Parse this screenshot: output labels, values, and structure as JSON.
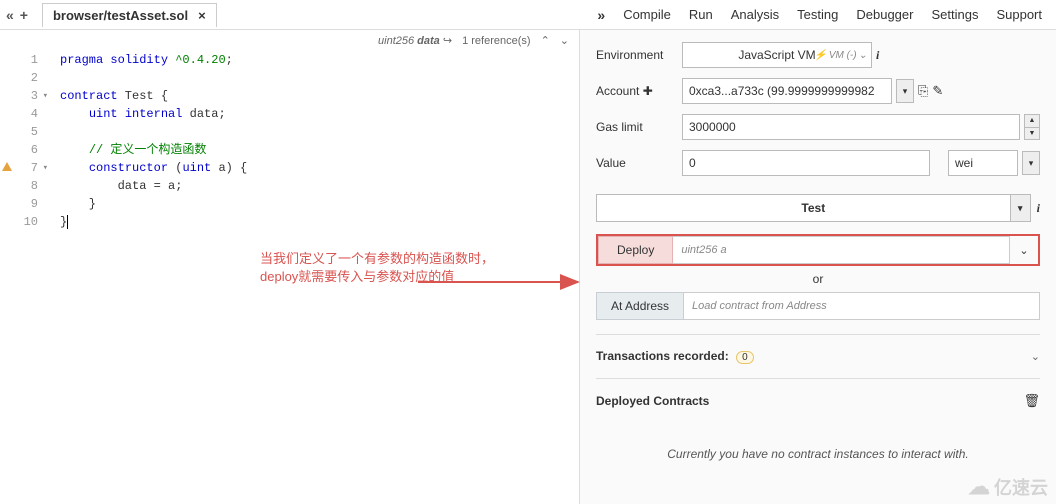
{
  "tabs": {
    "file_name": "browser/testAsset.sol",
    "nav": [
      "Compile",
      "Run",
      "Analysis",
      "Testing",
      "Debugger",
      "Settings",
      "Support"
    ],
    "active_nav": "Run"
  },
  "editor": {
    "hint_type": "uint256",
    "hint_name": "data",
    "references": "1 reference(s)",
    "lines": [
      {
        "n": 1,
        "tokens": [
          [
            "kw",
            "pragma"
          ],
          [
            "",
            " "
          ],
          [
            "kw",
            "solidity"
          ],
          [
            "",
            " "
          ],
          [
            "str",
            "^0.4.20"
          ],
          [
            "",
            ";"
          ]
        ]
      },
      {
        "n": 2,
        "tokens": []
      },
      {
        "n": 3,
        "fold": true,
        "tokens": [
          [
            "kw",
            "contract"
          ],
          [
            "",
            " Test {"
          ]
        ]
      },
      {
        "n": 4,
        "tokens": [
          [
            "",
            "    "
          ],
          [
            "type",
            "uint"
          ],
          [
            "",
            " "
          ],
          [
            "kw",
            "internal"
          ],
          [
            "",
            " data;"
          ]
        ]
      },
      {
        "n": 5,
        "tokens": []
      },
      {
        "n": 6,
        "tokens": [
          [
            "",
            "    "
          ],
          [
            "comment",
            "// 定义一个构造函数"
          ]
        ]
      },
      {
        "n": 7,
        "warn": true,
        "fold": true,
        "tokens": [
          [
            "",
            "    "
          ],
          [
            "kw",
            "constructor"
          ],
          [
            "",
            " ("
          ],
          [
            "type",
            "uint"
          ],
          [
            "",
            " a) {"
          ]
        ]
      },
      {
        "n": 8,
        "tokens": [
          [
            "",
            "        data = a;"
          ]
        ]
      },
      {
        "n": 9,
        "tokens": [
          [
            "",
            "    }"
          ]
        ]
      },
      {
        "n": 10,
        "cursor": true,
        "tokens": [
          [
            "",
            "}"
          ]
        ]
      }
    ]
  },
  "annotation": {
    "line1": "当我们定义了一个有参数的构造函数时，",
    "line2": "deploy就需要传入与参数对应的值"
  },
  "run": {
    "env_label": "Environment",
    "env_value": "JavaScript VM",
    "vm_badge": "VM (-)",
    "account_label": "Account",
    "account_value": "0xca3...a733c (99.9999999999982",
    "gas_label": "Gas limit",
    "gas_value": "3000000",
    "value_label": "Value",
    "value_value": "0",
    "value_unit": "wei",
    "contract_name": "Test",
    "deploy_label": "Deploy",
    "deploy_placeholder": "uint256 a",
    "or_text": "or",
    "ataddr_label": "At Address",
    "ataddr_placeholder": "Load contract from Address",
    "tx_title": "Transactions recorded:",
    "tx_count": "0",
    "deployed_title": "Deployed Contracts",
    "empty_msg": "Currently you have no contract instances to interact with."
  },
  "watermark": "亿速云"
}
